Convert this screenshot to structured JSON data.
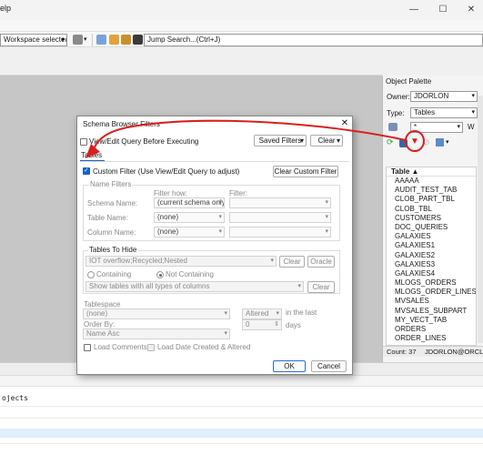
{
  "menu": {
    "help_fragment": "elp"
  },
  "window": {
    "minimize": "—",
    "maximize": "☐",
    "close": "✕"
  },
  "toolbar": {
    "workspace": "Workspace selected>",
    "jump_search": "Jump Search...(Ctrl+J)"
  },
  "output": {
    "text": "ojects"
  },
  "palette": {
    "title": "Object Palette",
    "owner_label": "Owner:",
    "owner_value": "JDORLON",
    "type_label": "Type:",
    "type_value": "Tables",
    "filter_value": "*",
    "filter_w": "W",
    "list_header": "Table ▲",
    "items": [
      "AAAAA",
      "AUDIT_TEST_TAB",
      "CLOB_PART_TBL",
      "CLOB_TBL",
      "CUSTOMERS",
      "DOC_QUERIES",
      "GALAXIES",
      "GALAXIES1",
      "GALAXIES2",
      "GALAXIES3",
      "GALAXIES4",
      "MLOGS_ORDERS",
      "MLOGS_ORDER_LINES",
      "MVSALES",
      "MVSALES_SUBPART",
      "MY_VECT_TAB",
      "ORDERS",
      "ORDER_LINES"
    ],
    "count": "Count: 37",
    "connection": "JDORLON@ORCL"
  },
  "dialog": {
    "title": "Schema Browser Filters",
    "close": "✕",
    "view_edit_query": "View/Edit Query Before Executing",
    "saved_filters": "Saved Filters",
    "clear": "Clear",
    "tab_tables": "Tables",
    "custom_filter": "Custom Filter (Use View/Edit Query to adjust)",
    "clear_custom_filter": "Clear Custom Filter",
    "name_filters": {
      "legend": "Name Filters",
      "filter_how": "Filter how:",
      "filter": "Filter:",
      "rows": [
        {
          "label": "Schema Name:",
          "how": "(current schema only"
        },
        {
          "label": "Table Name:",
          "how": "(none)"
        },
        {
          "label": "Column Name:",
          "how": "(none)"
        }
      ]
    },
    "tables_to_hide": {
      "legend": "Tables To Hide",
      "value": "IOT overflow;Recycled;Nested",
      "clear": "Clear",
      "oracle": "Oracle",
      "containing": "Containing",
      "not_containing": "Not Containing",
      "show_tables": "Show tables with all types of columns",
      "clear2": "Clear"
    },
    "tablespace": {
      "label": "Tablespace",
      "value": "(none)"
    },
    "altered": {
      "value": "Altered",
      "suffix": "in the last",
      "days_value": "0",
      "days_label": "days"
    },
    "order_by": {
      "label": "Order By:",
      "value": "Name Asc"
    },
    "load_comments": "Load Comments",
    "load_date": "Load Date Created & Altered",
    "ok": "OK",
    "cancel": "Cancel"
  },
  "colors": {
    "annotation": "#d91f1f",
    "accent": "#1560c9"
  }
}
